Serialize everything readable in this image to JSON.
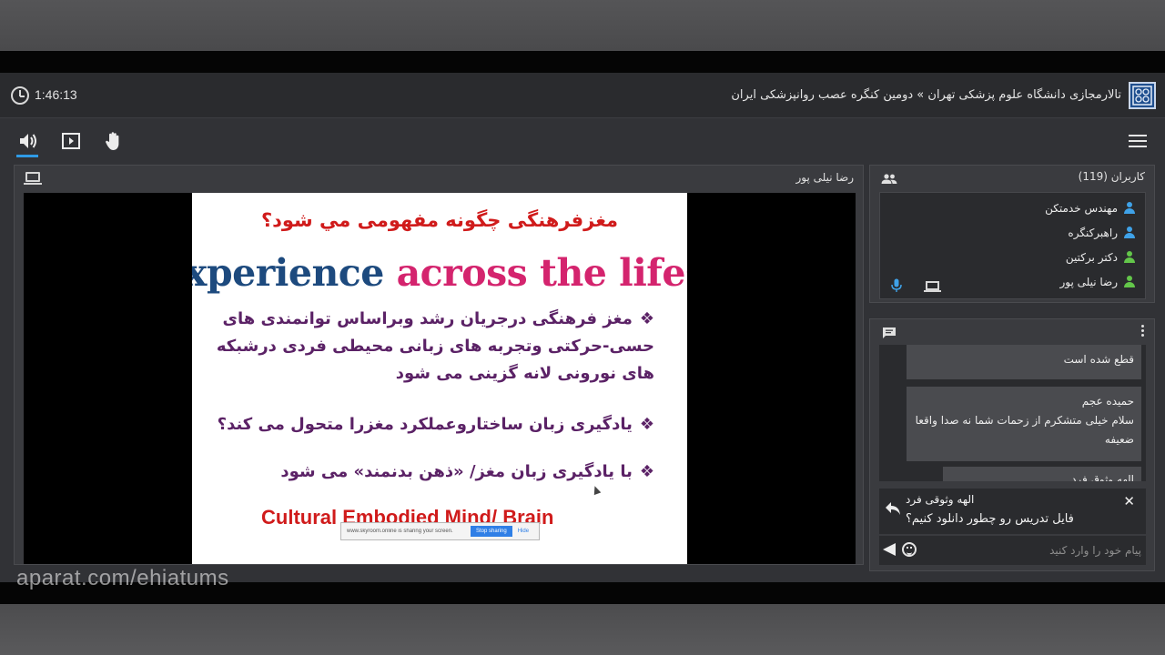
{
  "session": {
    "elapsed_time": "1:46:13",
    "breadcrumb": "تالارمجازی دانشگاه علوم پزشکی تهران » دومین کنگره عصب روانپزشکی ایران"
  },
  "video": {
    "presenter_name": "رضا نیلی پور",
    "slide": {
      "title": "مغزفرهنگی چگونه مفهومی مي شود؟",
      "banner_part1": "xperience",
      "banner_part2": "across the lifespa",
      "bullet1": "مغز فرهنگی درجریان رشد وبراساس توانمندی های حسی-حرکتی وتجربه های زبانی محیطی فردی درشبکه های نورونی لانه گزینی می شود",
      "bullet2": "یادگیری زبان ساختاروعملکرد مغزرا متحول می کند؟",
      "bullet3": "با یادگیری زبان مغز/ «ذهن بدنمند» می شود",
      "bullet_mark": "❖",
      "footer": "Cultural  Embodied Mind/ Brain"
    },
    "share_bar": {
      "text": "www.skyroom.online is sharing your screen.",
      "stop_label": "Stop sharing",
      "hide_label": "Hide"
    }
  },
  "users": {
    "title": "کاربران (119)",
    "list": [
      {
        "name": "مهندس خدمتکن",
        "color": "#3fa2e8"
      },
      {
        "name": "راهبرکنگره",
        "color": "#3fa2e8"
      },
      {
        "name": "دکتر برکتین",
        "color": "#63c64a"
      },
      {
        "name": "رضا نیلی پور",
        "color": "#63c64a"
      }
    ]
  },
  "chat": {
    "messages": [
      {
        "name": "",
        "text": "قطع شده است"
      },
      {
        "name": "حمیده عجم",
        "text": "سلام خیلی متشکرم از زحمات شما نه صدا واقعا ضعیفه"
      },
      {
        "name": "الهه وثوق فرد",
        "text": ""
      }
    ],
    "reply_to": {
      "name": "الهه وثوقی فرد",
      "text": "فایل تدریس رو چطور دانلود کنیم؟"
    },
    "input_placeholder": "پیام خود را وارد کنید"
  },
  "watermark": "aparat.com/ehiatums"
}
